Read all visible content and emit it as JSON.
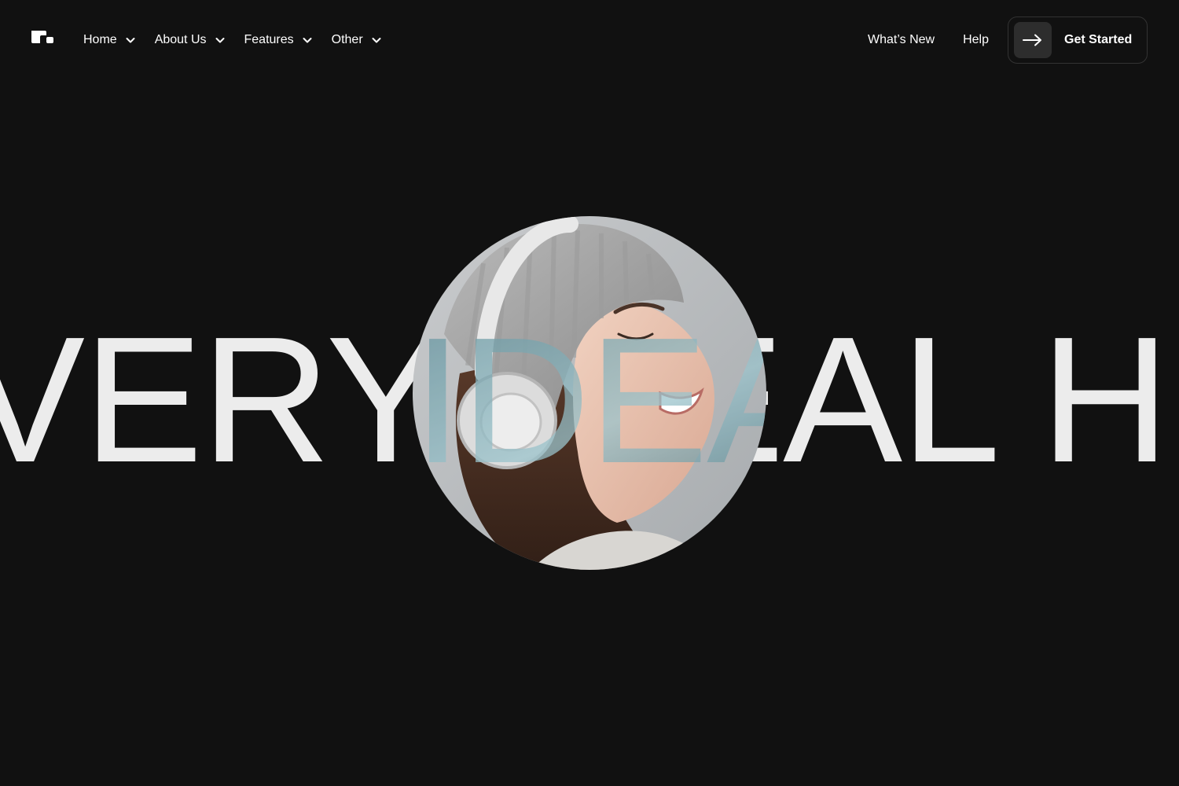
{
  "nav": {
    "logo_icon": "brand-blocks-icon",
    "menu": [
      {
        "label": "Home",
        "icon": "chevron-down-icon"
      },
      {
        "label": "About Us",
        "icon": "chevron-down-icon"
      },
      {
        "label": "Features",
        "icon": "chevron-down-icon"
      },
      {
        "label": "Other",
        "icon": "chevron-down-icon"
      }
    ],
    "whats_new": "What’s New",
    "help": "Help",
    "cta": {
      "label": "Get Started",
      "icon": "arrow-right-icon"
    }
  },
  "hero": {
    "headline": "VERY IDEAL HIGH",
    "image_subject": "woman-with-headphones"
  },
  "colors": {
    "background": "#111111",
    "text": "#ffffff",
    "headline": "#ececec",
    "cta_border": "#333333",
    "cta_icon_bg": "#2d2d2d"
  }
}
